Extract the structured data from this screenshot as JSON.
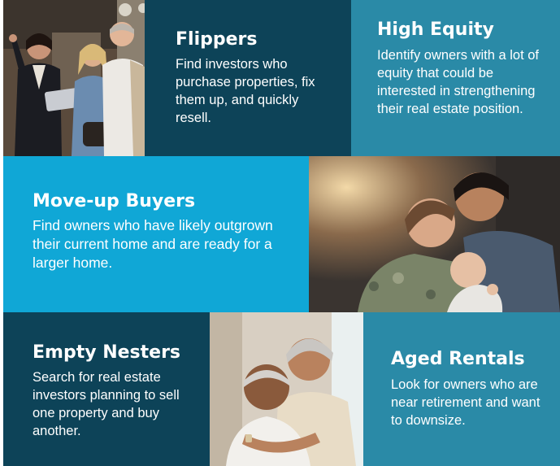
{
  "tiles": {
    "flippers": {
      "title": "Flippers",
      "description": "Find investors who purchase properties, fix them up, and quickly resell."
    },
    "high_equity": {
      "title": "High Equity",
      "description": "Identify owners with a lot of equity that could be interested in strengthening their real estate position."
    },
    "move_up_buyers": {
      "title": "Move-up Buyers",
      "description": "Find owners who have likely outgrown their current home and are ready for a larger home."
    },
    "empty_nesters": {
      "title": "Empty Nesters",
      "description": "Search for real estate investors planning to sell one property and buy another."
    },
    "aged_rentals": {
      "title": "Aged Rentals",
      "description": "Look for owners who are near retirement and want to downsize."
    }
  },
  "colors": {
    "dark_navy": "#0d4358",
    "teal": "#2a8aa7",
    "bright_blue": "#10a7d6"
  }
}
